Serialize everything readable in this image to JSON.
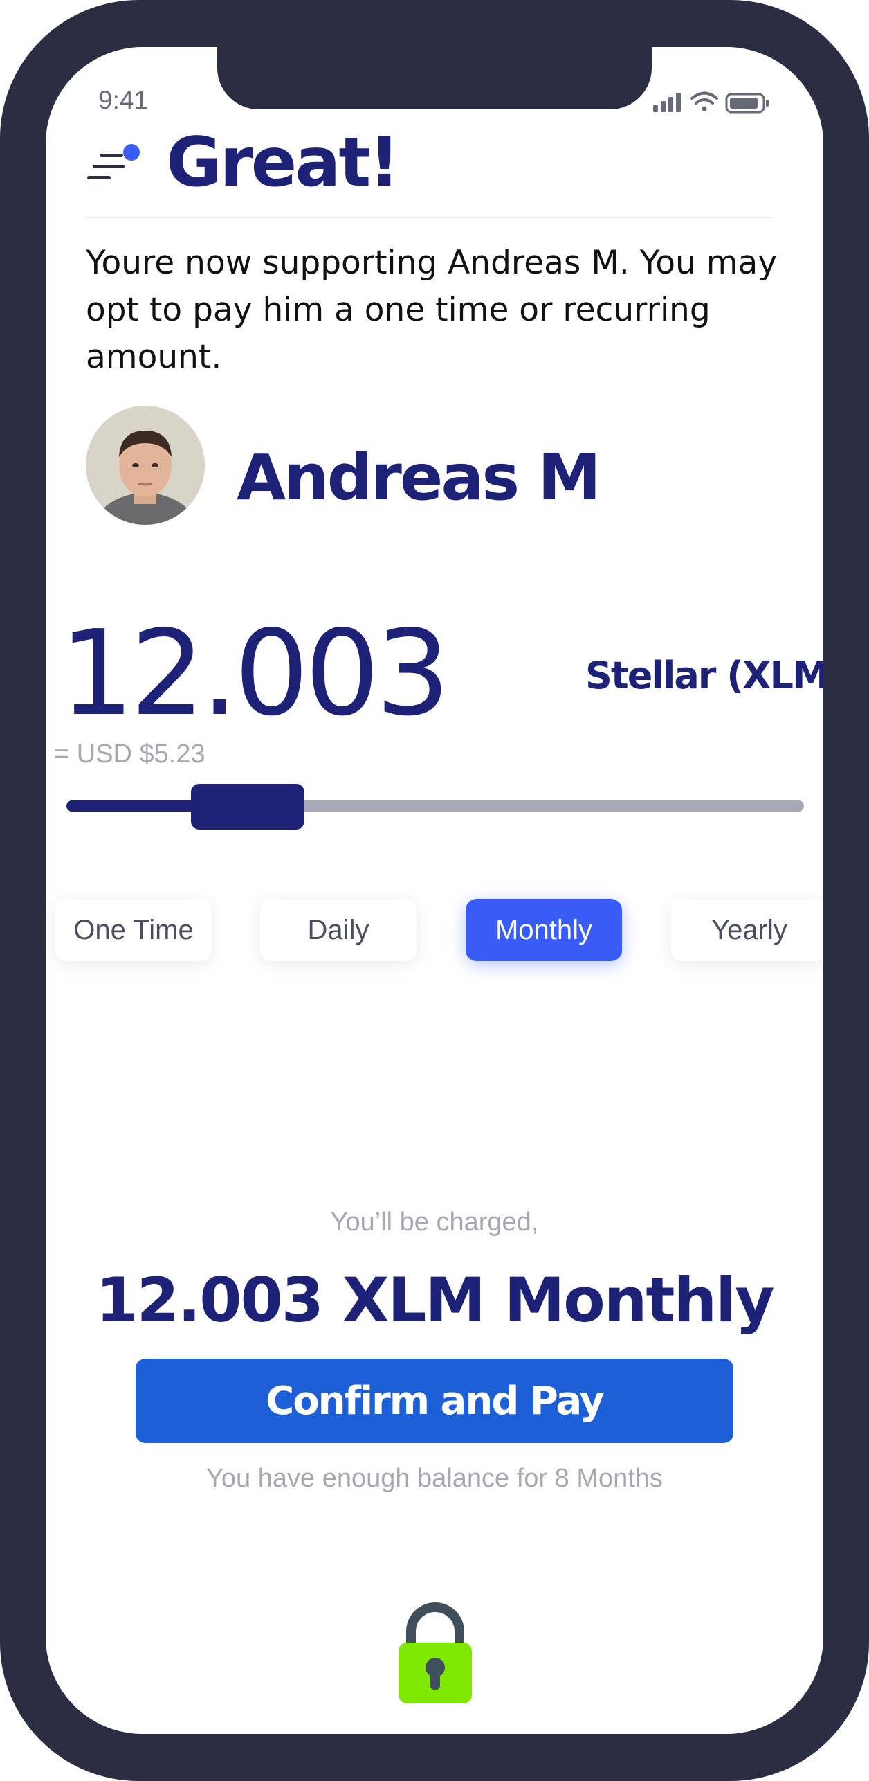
{
  "status_bar": {
    "time": "9:41",
    "icons": [
      "signal-icon",
      "wifi-icon",
      "battery-icon"
    ]
  },
  "header": {
    "title": "Great!",
    "menu_icon": "menu-icon",
    "notification_dot_color": "#3a5cf6"
  },
  "intro": {
    "text": "Youre now supporting Andreas M. You may opt to pay him a one time or recurring amount."
  },
  "recipient": {
    "name": "Andreas M",
    "avatar_icon": "avatar"
  },
  "amount": {
    "value": "12.003",
    "currency": "Stellar (XLM)",
    "usd_equivalent": "= USD $5.23",
    "slider_level": 0.2
  },
  "frequency": {
    "options": [
      {
        "label": "One Time",
        "active": false
      },
      {
        "label": "Daily",
        "active": false
      },
      {
        "label": "Monthly",
        "active": true
      },
      {
        "label": "Yearly",
        "active": false
      }
    ]
  },
  "summary": {
    "charge_label": "You’ll be charged,",
    "charge_text": "12.003 XLM Monthly",
    "confirm_label": "Confirm and Pay",
    "balance_note": "You have enough balance for 8 Months"
  },
  "footer": {
    "lock_icon": "lock-icon"
  },
  "colors": {
    "primary_navy": "#1d2277",
    "accent_blue": "#3a5cf6",
    "button_blue": "#1c5fd6",
    "lock_green": "#7ee800",
    "frame": "#2b2d42"
  }
}
